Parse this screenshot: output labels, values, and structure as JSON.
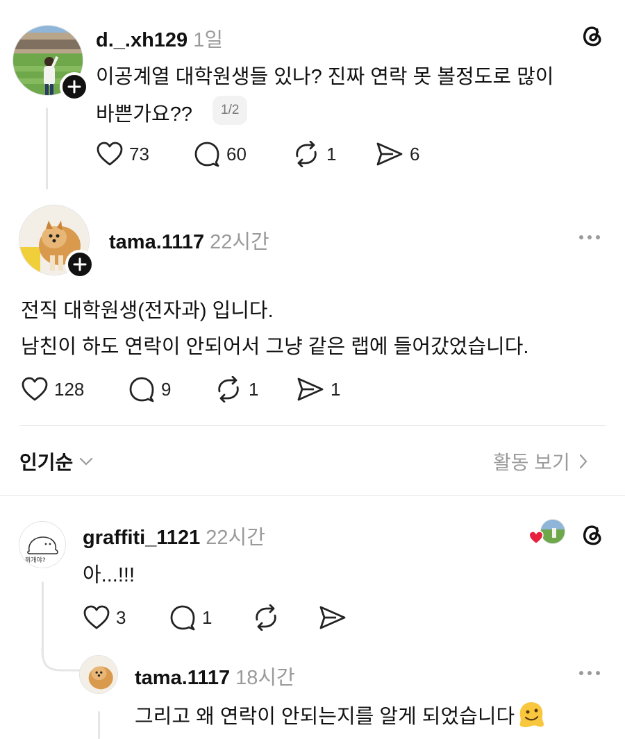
{
  "post1": {
    "username": "d._.xh129",
    "time": "1일",
    "text_line1": "이공계열 대학원생들 있나? 진짜 연락 못 볼정도로 많이",
    "text_line2": "바쁜가요??",
    "page_indicator": "1/2",
    "likes": "73",
    "replies": "60",
    "reposts": "1",
    "shares": "6"
  },
  "post2": {
    "username": "tama.1117",
    "time": "22시간",
    "text_line1": "전직 대학원생(전자과) 입니다.",
    "text_line2": "남친이 하도 연락이 안되어서 그냥 같은 랩에 들어갔었습니다.",
    "likes": "128",
    "replies": "9",
    "reposts": "1",
    "shares": "1"
  },
  "sort": {
    "label": "인기순",
    "activity_label": "활동 보기"
  },
  "comment1": {
    "username": "graffiti_1121",
    "time": "22시간",
    "text": "아...!!!",
    "avatar_caption": "뭐개야?",
    "likes": "3",
    "replies": "1"
  },
  "comment2": {
    "username": "tama.1117",
    "time": "18시간",
    "text": "그리고 왜 연락이 안되는지를 알게 되었습니다"
  },
  "colors": {
    "text": "#111111",
    "muted": "#9a9a9a",
    "divider": "#e6e6e6",
    "heart": "#e8213e"
  },
  "icons": [
    "threads-icon",
    "heart-icon",
    "comment-icon",
    "repost-icon",
    "share-icon",
    "plus-icon",
    "more-icon",
    "chevron-down-icon",
    "chevron-right-icon",
    "melting-face-emoji"
  ]
}
